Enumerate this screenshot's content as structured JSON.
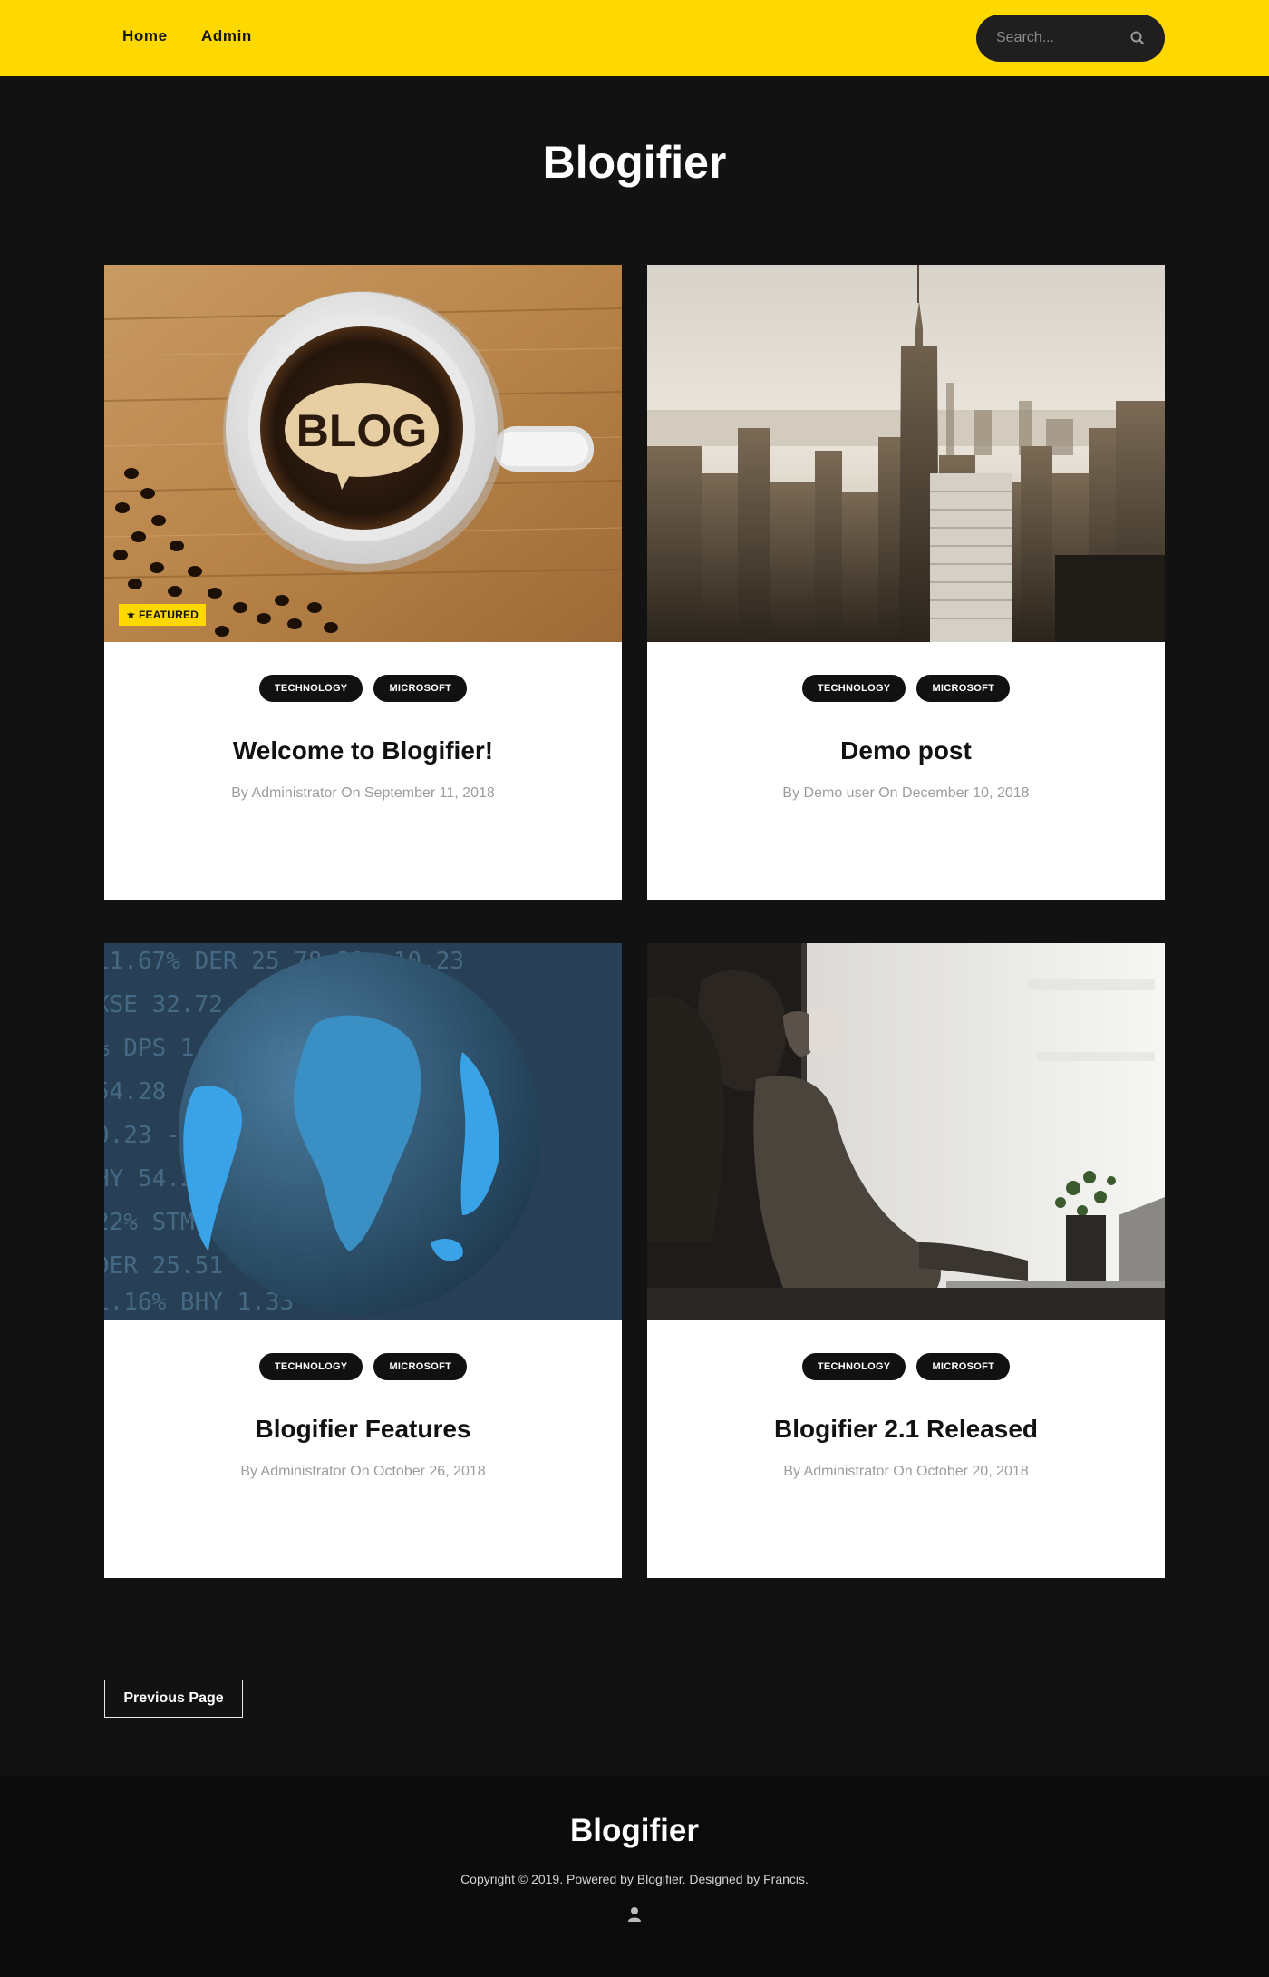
{
  "nav": {
    "items": [
      {
        "label": "Home"
      },
      {
        "label": "Admin"
      }
    ]
  },
  "search": {
    "placeholder": "Search...",
    "value": "",
    "icon": "search-icon"
  },
  "site": {
    "title": "Blogifier"
  },
  "colors": {
    "accent": "#ffd800",
    "background": "#121212",
    "footer": "#0b0b0b",
    "card": "#ffffff",
    "tag": "#111111"
  },
  "posts": [
    {
      "title": "Welcome to Blogifier!",
      "meta": "By Administrator On September 11, 2018",
      "tags": [
        "TECHNOLOGY",
        "MICROSOFT"
      ],
      "featured": "FEATURED",
      "featured_icon": "star-icon",
      "image": "coffee-cup-blog"
    },
    {
      "title": "Demo post",
      "meta": "By Demo user On December 10, 2018",
      "tags": [
        "TECHNOLOGY",
        "MICROSOFT"
      ],
      "image": "city-skyline"
    },
    {
      "title": "Blogifier Features",
      "meta": "By Administrator On October 26, 2018",
      "tags": [
        "TECHNOLOGY",
        "MICROSOFT"
      ],
      "image": "globe-stock-ticker"
    },
    {
      "title": "Blogifier 2.1 Released",
      "meta": "By Administrator On October 20, 2018",
      "tags": [
        "TECHNOLOGY",
        "MICROSOFT"
      ],
      "image": "woman-laptop"
    }
  ],
  "pagination": {
    "prev_label": "Previous Page"
  },
  "footer": {
    "title": "Blogifier",
    "copyright": "Copyright © 2019. Powered by Blogifier. Designed by Francis.",
    "user_icon": "user-icon"
  }
}
